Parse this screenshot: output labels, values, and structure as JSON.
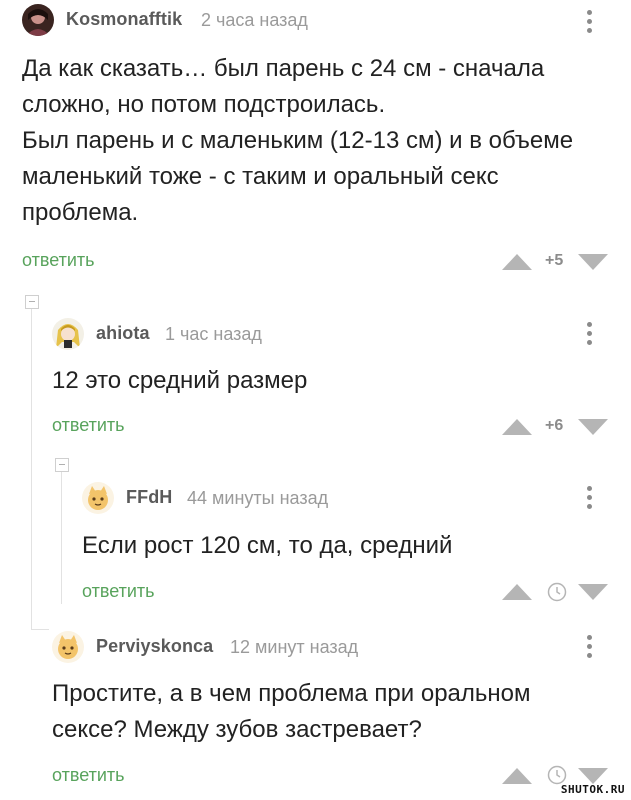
{
  "comments": [
    {
      "author": "Kosmonafftik",
      "time": "2 часа назад",
      "lines": [
        "Да как сказать… был парень с 24 см - сначала",
        "сложно, но потом подстроилась.",
        "Был парень и с маленьким (12-13 см) и в объеме",
        "маленький тоже - с таким и оральный секс",
        "проблема."
      ],
      "reply_label": "ответить",
      "score": "+5",
      "avatar_icon": "avatar-dark-photo"
    },
    {
      "author": "ahiota",
      "time": "1 час назад",
      "lines": [
        "12 это средний размер"
      ],
      "reply_label": "ответить",
      "score": "+6",
      "avatar_icon": "avatar-anime-girl"
    },
    {
      "author": "FFdH",
      "time": "44 минуты назад",
      "lines": [
        "Если рост 120 см, то да, средний"
      ],
      "reply_label": "ответить",
      "score_icon": "clock-icon",
      "avatar_icon": "avatar-yellow-cat"
    },
    {
      "author": "Perviyskonca",
      "time": "12 минут назад",
      "lines": [
        "Простите, а в чем проблема при оральном",
        "сексе? Между зубов застревает?"
      ],
      "reply_label": "ответить",
      "score_icon": "clock-icon",
      "avatar_icon": "avatar-yellow-cat"
    }
  ],
  "watermark": "SHUTOK.RU",
  "colors": {
    "reply_green": "#58a35c",
    "arrow_gray": "#b5b5b5",
    "thread_line": "#e2e2e2"
  }
}
